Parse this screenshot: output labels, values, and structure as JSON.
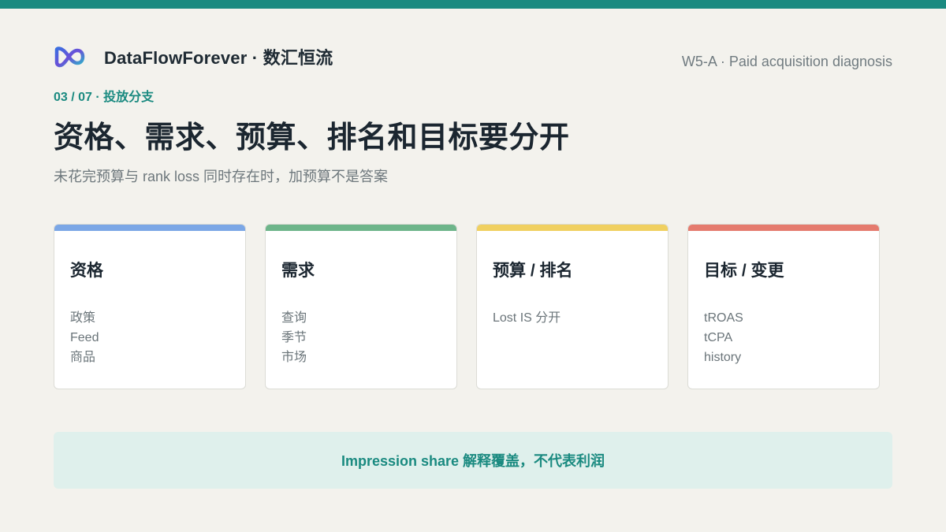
{
  "colors": {
    "top_bar": "#1a8a80",
    "accent": "#1a8a80",
    "background": "#f3f2ed",
    "callout_bg": "#dff0ec"
  },
  "brand": {
    "logo_icon": "infinity-logo-icon",
    "name": "DataFlowForever · 数汇恒流"
  },
  "header_meta": "W5-A · Paid acquisition diagnosis",
  "section_label": "03 / 07 · 投放分支",
  "title": "资格、需求、预算、排名和目标要分开",
  "subtitle": "未花完预算与 rank loss 同时存在时，加预算不是答案",
  "cards": [
    {
      "title": "资格",
      "accent": "#7ba7e6",
      "items": [
        "政策",
        "Feed",
        "商品"
      ]
    },
    {
      "title": "需求",
      "accent": "#6db58a",
      "items": [
        "查询",
        "季节",
        "市场"
      ]
    },
    {
      "title": "预算 / 排名",
      "accent": "#f0d060",
      "items": [
        "Lost IS 分开"
      ]
    },
    {
      "title": "目标 / 变更",
      "accent": "#e57b6e",
      "items": [
        "tROAS",
        "tCPA",
        "history"
      ]
    }
  ],
  "callout": "Impression share 解释覆盖，不代表利润"
}
